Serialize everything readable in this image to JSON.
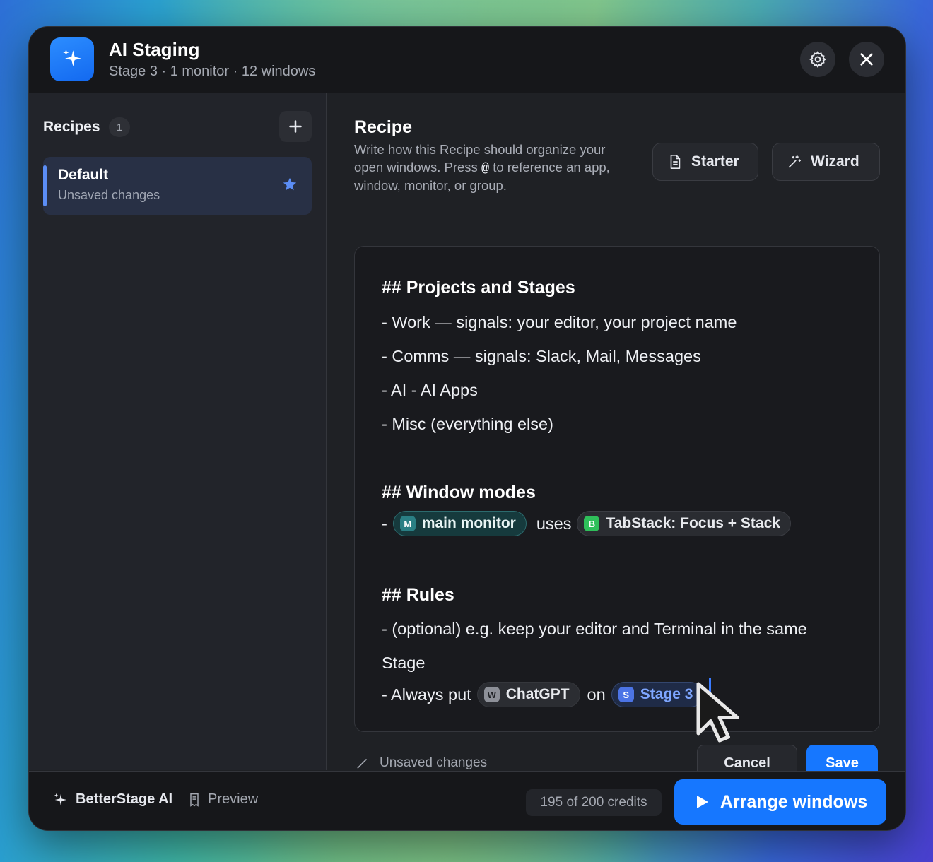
{
  "header": {
    "title": "AI Staging",
    "subtitle": "Stage 3 · 1 monitor · 12 windows",
    "icon": "sparkles-icon",
    "accent": "#1677ff"
  },
  "sidebar": {
    "title": "Recipes",
    "count": "1",
    "items": [
      {
        "name": "Default",
        "status": "Unsaved changes",
        "starred": true
      }
    ]
  },
  "recipe": {
    "title": "Recipe",
    "description_before": "Write how this Recipe should organize your open windows. Press ",
    "description_key": "@",
    "description_after": " to reference an app, window, monitor, or group.",
    "starter_label": "Starter",
    "wizard_label": "Wizard"
  },
  "editor": {
    "h_projects": "## Projects and Stages",
    "line_work": "- Work — signals: your editor, your project name",
    "line_comms": "- Comms — signals: Slack, Mail, Messages",
    "line_ai": "- AI - AI Apps",
    "line_misc": "- Misc (everything else)",
    "h_modes": "## Window modes",
    "modes_dash": "-",
    "token_monitor_badge": "M",
    "token_monitor": "main monitor",
    "modes_uses": "uses",
    "token_layout_badge": "B",
    "token_layout": "TabStack: Focus + Stack",
    "h_rules": "## Rules",
    "rule_optional_1": "- (optional) e.g. keep your editor and Terminal in the same",
    "rule_optional_2": "Stage",
    "rule_always": "- Always put",
    "token_app_badge": "W",
    "token_app": "ChatGPT",
    "rule_on": "on",
    "token_stage_badge": "S",
    "token_stage": "Stage 3"
  },
  "status": {
    "text": "Unsaved changes"
  },
  "actions": {
    "cancel": "Cancel",
    "save": "Save"
  },
  "footer": {
    "brand": "BetterStage AI",
    "preview": "Preview",
    "credits": "195 of 200 credits",
    "arrange": "Arrange windows"
  }
}
